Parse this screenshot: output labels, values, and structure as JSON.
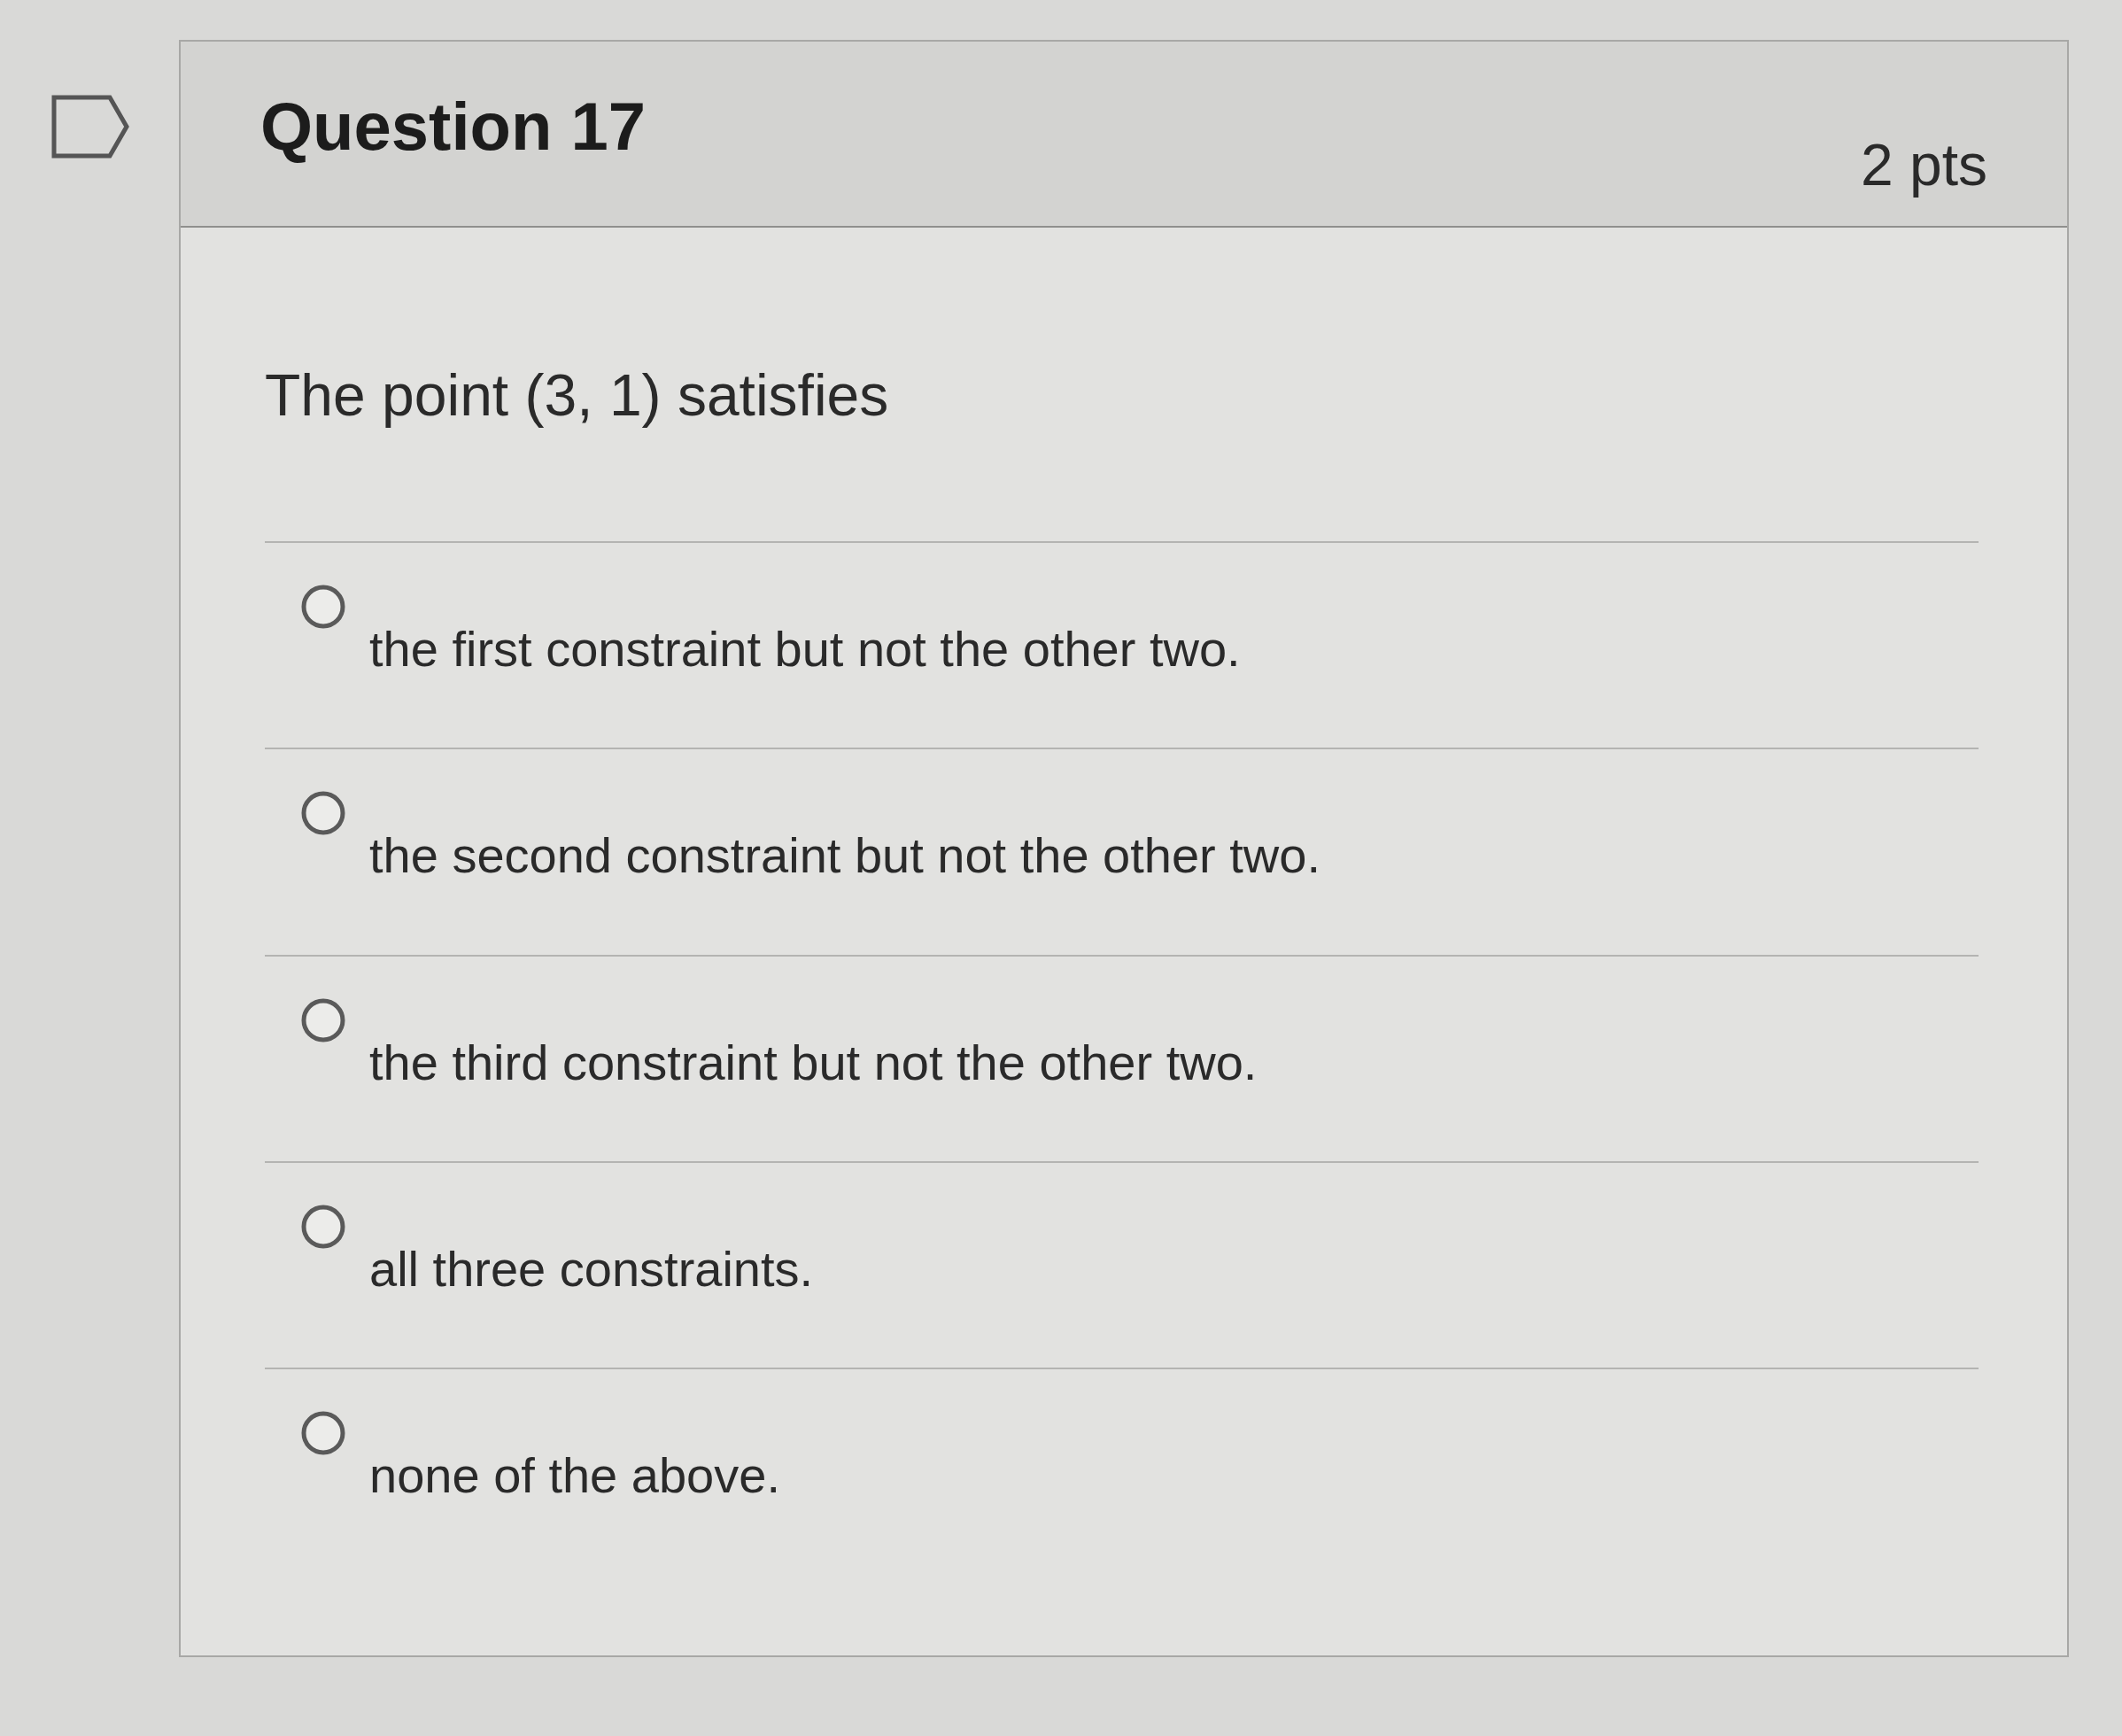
{
  "question": {
    "flagged": false,
    "title": "Question 17",
    "points": "2 pts",
    "prompt": "The point (3, 1) satisfies"
  },
  "options": [
    {
      "label": "the first constraint but not the other two.",
      "selected": false
    },
    {
      "label": "the second constraint but not the other two.",
      "selected": false
    },
    {
      "label": "the third constraint but not the other two.",
      "selected": false
    },
    {
      "label": "all three constraints.",
      "selected": false
    },
    {
      "label": "none of the above.",
      "selected": false
    }
  ]
}
